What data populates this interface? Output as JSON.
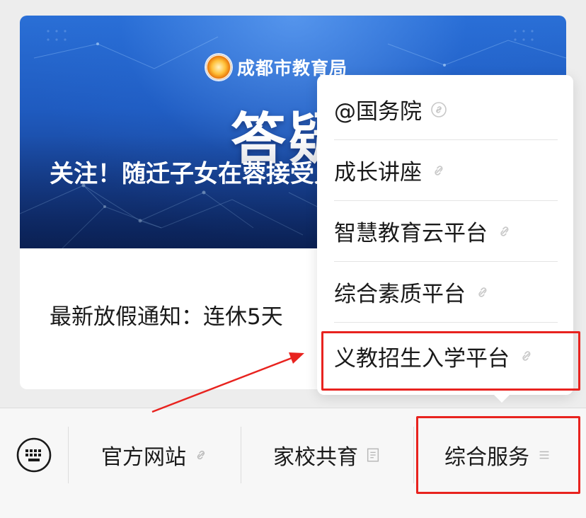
{
  "card": {
    "brand_name": "成都市教育局",
    "cover_big_text": "答疑",
    "headline": "关注！随迁子女在蓉接受义务教育，热问热答",
    "second_item": "最新放假通知：连休5天"
  },
  "menu": {
    "items": [
      {
        "label": "@国务院",
        "icon": "link-icon"
      },
      {
        "label": "成长讲座",
        "icon": "link-icon"
      },
      {
        "label": "智慧教育云平台",
        "icon": "link-icon"
      },
      {
        "label": "综合素质平台",
        "icon": "link-icon"
      },
      {
        "label": "义教招生入学平台",
        "icon": "link-icon"
      }
    ]
  },
  "bottom_bar": {
    "keyboard_icon": "keyboard-icon",
    "tabs": [
      {
        "label": "官方网站",
        "icon": "link-icon"
      },
      {
        "label": "家校共育",
        "icon": "page-icon"
      },
      {
        "label": "综合服务",
        "icon": "menu-lines-icon"
      }
    ]
  },
  "annotation": {
    "color": "#e8231f"
  }
}
